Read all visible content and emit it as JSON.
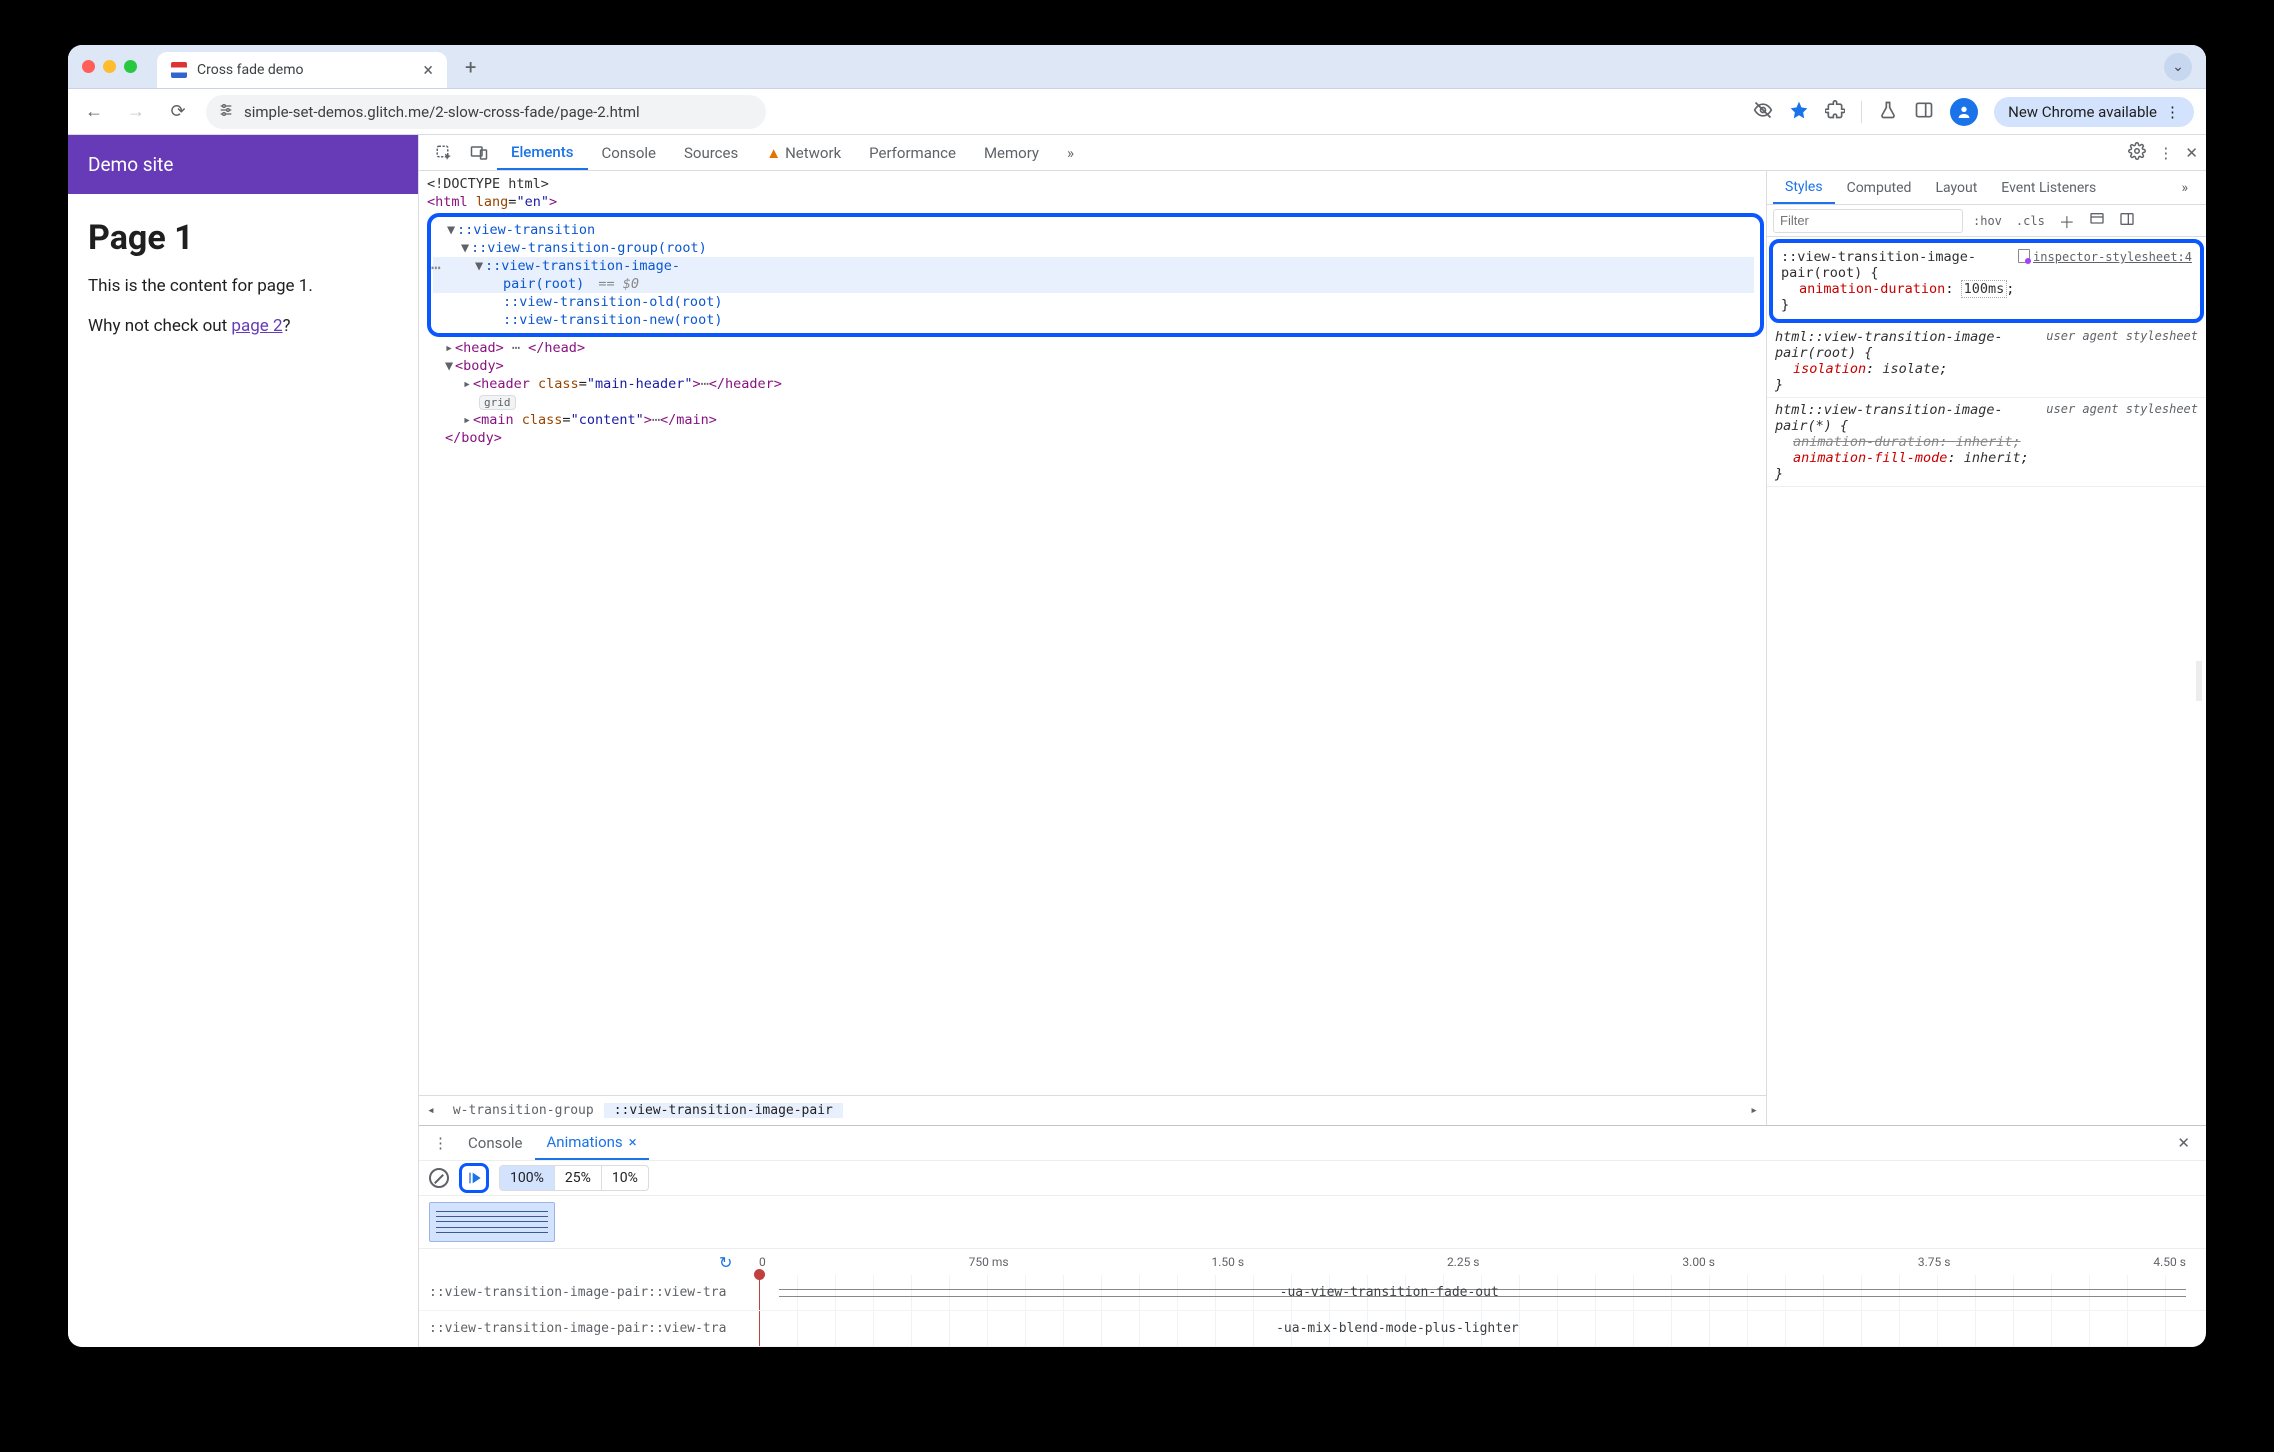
{
  "window": {
    "tab_title": "Cross fade demo"
  },
  "toolbar": {
    "url": "simple-set-demos.glitch.me/2-slow-cross-fade/page-2.html",
    "update_label": "New Chrome available"
  },
  "page": {
    "site_title": "Demo site",
    "heading": "Page 1",
    "body": "This is the content for page 1.",
    "cta_prefix": "Why not check out ",
    "cta_link": "page 2",
    "cta_suffix": "?"
  },
  "devtools": {
    "tabs": [
      "Elements",
      "Console",
      "Sources",
      "Network",
      "Performance",
      "Memory"
    ],
    "active_tab": "Elements",
    "styles_tabs": [
      "Styles",
      "Computed",
      "Layout",
      "Event Listeners"
    ],
    "styles_filter_placeholder": "Filter",
    "styles_tools": {
      "hov": ":hov",
      "cls": ".cls"
    },
    "dom": {
      "doctype": "<!DOCTYPE html>",
      "html_open": "<html lang=\"en\">",
      "vt": "::view-transition",
      "vtg": "::view-transition-group(root)",
      "vtip_a": "::view-transition-image-",
      "vtip_b": "pair(root)",
      "sel0": "== $0",
      "vtold": "::view-transition-old(root)",
      "vtnew": "::view-transition-new(root)",
      "head": "<head>…</head>",
      "body_open": "<body>",
      "header": "<header class=\"main-header\">…</header>",
      "grid_pill": "grid",
      "main": "<main class=\"content\">…</main>",
      "body_close": "</body>",
      "ellipsis": "⋯"
    },
    "crumbs": {
      "prev": "w-transition-group",
      "cur": "::view-transition-image-pair"
    },
    "rules": [
      {
        "selector": "::view-transition-image-pair(root) {",
        "source": "inspector-stylesheet:4",
        "source_kind": "link",
        "decls": [
          {
            "prop": "animation-duration",
            "val": "100ms",
            "edit": true
          }
        ],
        "highlight": true
      },
      {
        "selector": "html::view-transition-image-pair(root) {",
        "source": "user agent stylesheet",
        "source_kind": "ua",
        "decls": [
          {
            "prop": "isolation",
            "val": "isolate",
            "italic": true
          }
        ]
      },
      {
        "selector": "html::view-transition-image-pair(*) {",
        "source": "user agent stylesheet",
        "source_kind": "ua",
        "decls": [
          {
            "prop": "animation-duration",
            "val": "inherit",
            "strike": true,
            "italic": true
          },
          {
            "prop": "animation-fill-mode",
            "val": "inherit",
            "italic": true
          }
        ]
      }
    ]
  },
  "drawer": {
    "tabs": [
      "Console",
      "Animations"
    ],
    "active": "Animations",
    "speeds": [
      "100%",
      "25%",
      "10%"
    ],
    "active_speed": "100%",
    "timeline_ticks": [
      "0",
      "750 ms",
      "1.50 s",
      "2.25 s",
      "3.00 s",
      "3.75 s",
      "4.50 s"
    ],
    "rows": [
      {
        "name": "::view-transition-image-pair::view-tra",
        "label": "-ua-view-transition-fade-out"
      },
      {
        "name": "::view-transition-image-pair::view-tra",
        "label": "-ua-mix-blend-mode-plus-lighter"
      }
    ]
  }
}
